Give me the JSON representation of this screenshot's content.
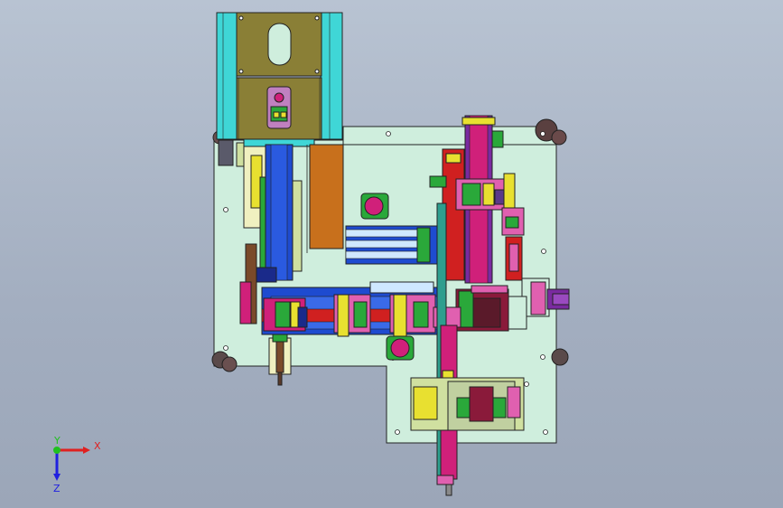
{
  "viewport": {
    "background_top": "#b8c3d2",
    "background_bottom": "#9ba6b8"
  },
  "model": {
    "plate_color": "#cfeedd",
    "edge_color": "#222222",
    "colors": {
      "cyan": "#3fd6d6",
      "olive": "#8a7f36",
      "orange": "#c8701c",
      "magenta": "#d0207a",
      "pink": "#e060b0",
      "green": "#2aa83a",
      "yellow": "#e8e030",
      "blue": "#1e4bd0",
      "navy": "#1a2a8a",
      "red": "#d02020",
      "purple": "#7a2aa0",
      "gray": "#8a8a8a",
      "brown": "#7a4a2a",
      "teal": "#2e9e8e"
    }
  },
  "triad": {
    "x_label": "X",
    "y_label": "Y",
    "z_label": "Z",
    "x_color": "#e02020",
    "y_color": "#20c020",
    "z_color": "#2020e0"
  }
}
